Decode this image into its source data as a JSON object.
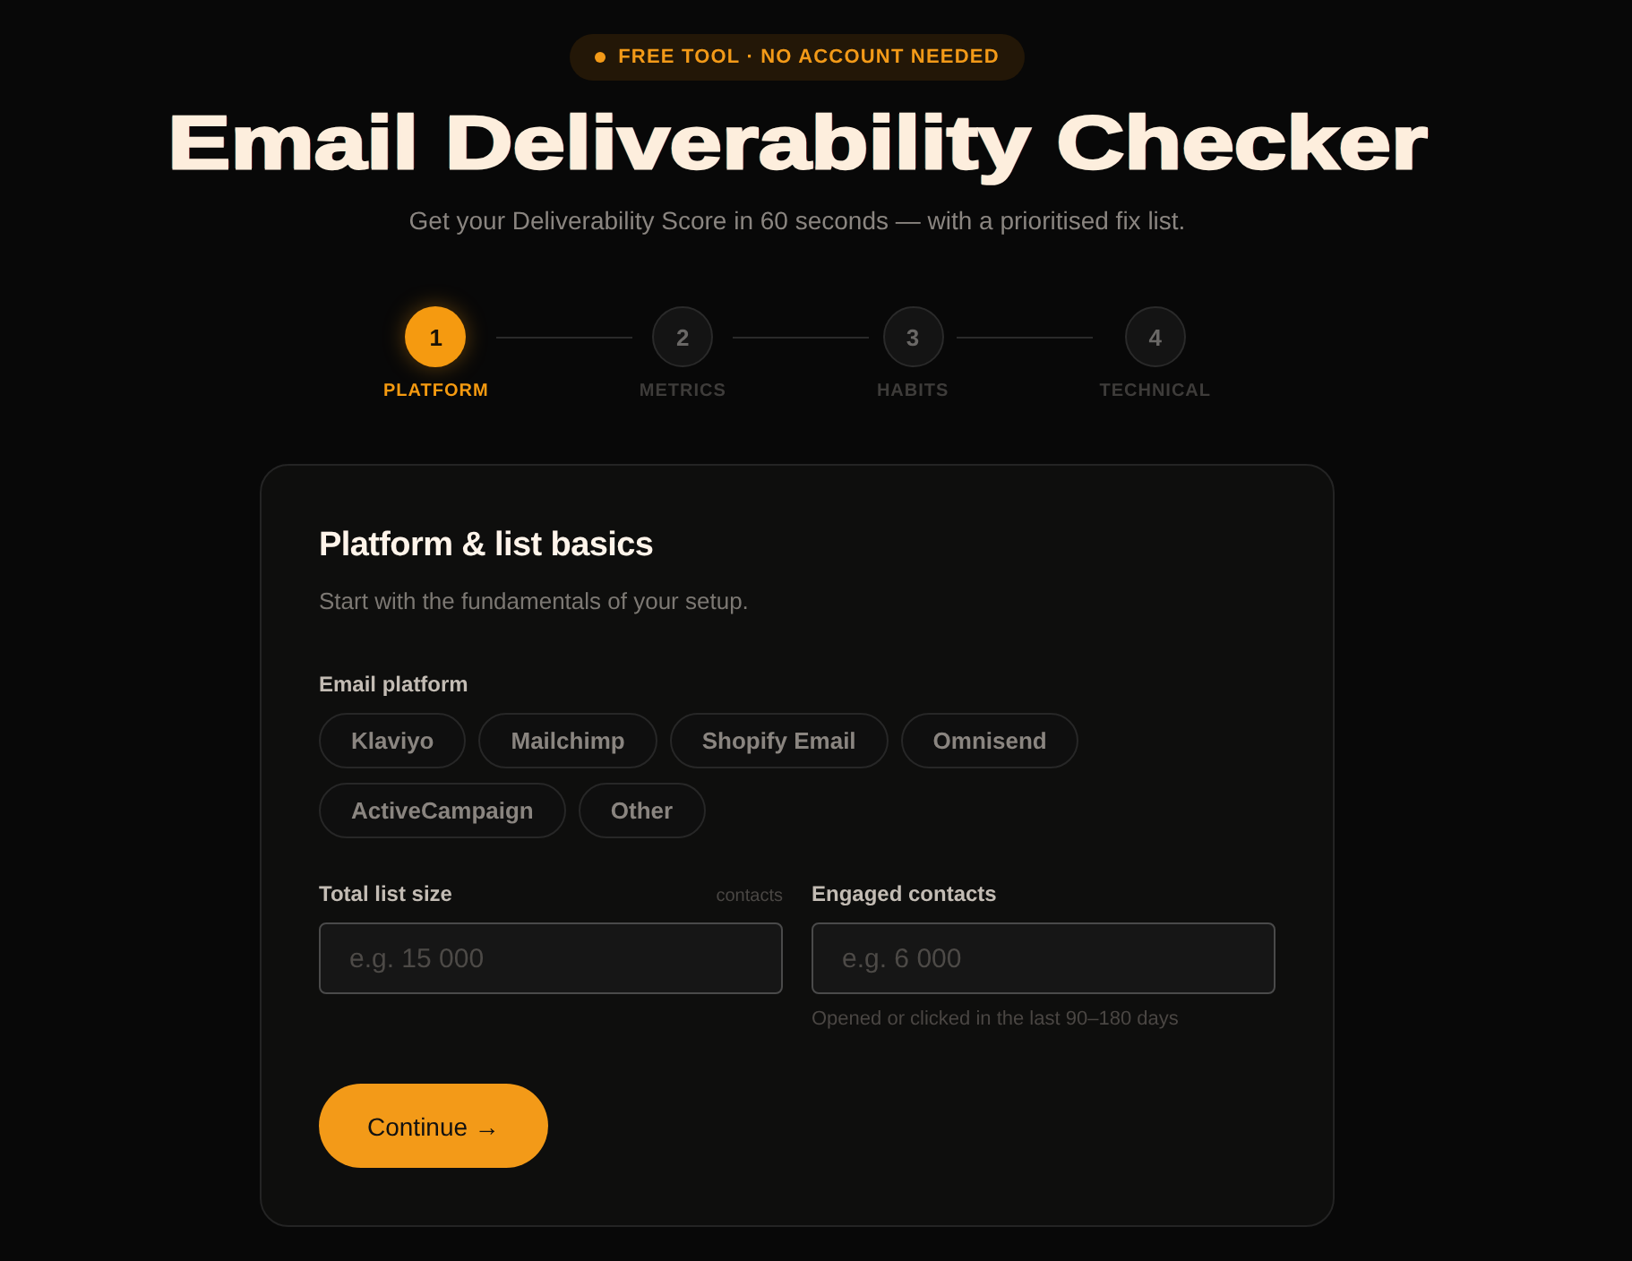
{
  "badge": {
    "text": "FREE TOOL · NO ACCOUNT NEEDED"
  },
  "title": "Email Deliverability Checker",
  "subtitle": "Get your Deliverability Score in 60 seconds — with a prioritised fix list.",
  "steps": [
    {
      "number": "1",
      "label": "PLATFORM",
      "selected": true
    },
    {
      "number": "2",
      "label": "METRICS",
      "selected": false
    },
    {
      "number": "3",
      "label": "HABITS",
      "selected": false
    },
    {
      "number": "4",
      "label": "TECHNICAL",
      "selected": false
    }
  ],
  "card": {
    "title": "Platform & list basics",
    "subtitle": "Start with the fundamentals of your setup.",
    "platform": {
      "label": "Email platform",
      "options": [
        {
          "label": "Klaviyo",
          "selected": false
        },
        {
          "label": "Mailchimp",
          "selected": false
        },
        {
          "label": "Shopify Email",
          "selected": false
        },
        {
          "label": "Omnisend",
          "selected": false
        },
        {
          "label": "ActiveCampaign",
          "selected": false
        },
        {
          "label": "Other",
          "selected": false
        }
      ]
    },
    "fields": [
      {
        "label": "Total list size",
        "unit": "contacts",
        "placeholder": "e.g. 15 000"
      },
      {
        "label": "Engaged contacts",
        "placeholder": "e.g. 6 000",
        "hint": "Opened or clicked in the last 90–180 days"
      }
    ],
    "button": "Continue →"
  }
}
